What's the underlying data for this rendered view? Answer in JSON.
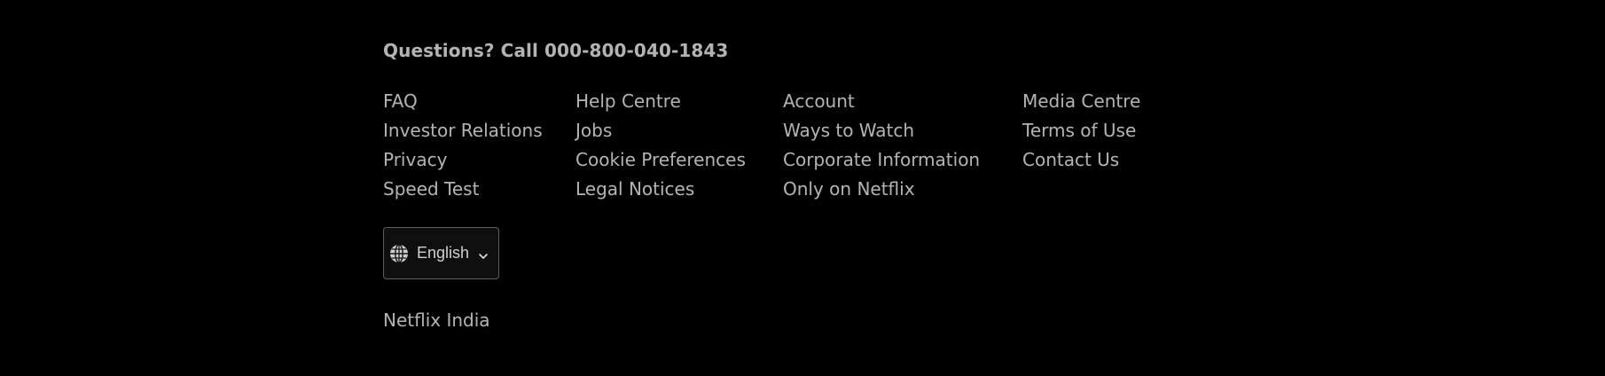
{
  "footer": {
    "questions_text": "Questions? Call ",
    "phone": "000-800-040-1843",
    "columns": [
      [
        "FAQ",
        "Investor Relations",
        "Privacy",
        "Speed Test"
      ],
      [
        "Help Centre",
        "Jobs",
        "Cookie Preferences",
        "Legal Notices"
      ],
      [
        "Account",
        "Ways to Watch",
        "Corporate Information",
        "Only on Netflix"
      ],
      [
        "Media Centre",
        "Terms of Use",
        "Contact Us"
      ]
    ],
    "language": {
      "selected": "English",
      "icon": "globe-icon",
      "chevron_icon": "chevron-down-icon"
    },
    "country": "Netflix India"
  },
  "colors": {
    "background": "#000000",
    "text": "rgba(255,255,255,0.7)"
  }
}
